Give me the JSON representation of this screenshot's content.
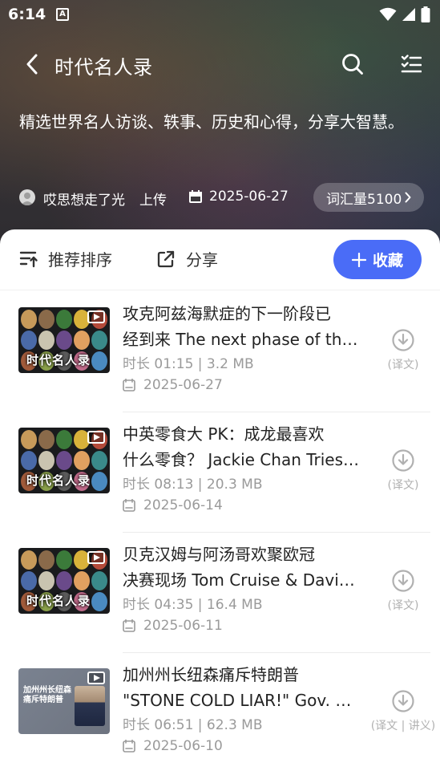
{
  "status": {
    "time": "6:14",
    "badge": "A"
  },
  "nav": {
    "title": "时代名人录"
  },
  "header": {
    "description": "精选世界名人访谈、轶事、历史和心得，分享大智慧。",
    "uploader": "哎思想走了光",
    "upload_word": "上传",
    "date": "2025-06-27",
    "vocab": "词汇量5100"
  },
  "toolbar": {
    "sort_label": "推荐排序",
    "share_label": "分享",
    "favorite_label": "收藏"
  },
  "items": [
    {
      "thumb_label": "时代名人录",
      "title_line1": "攻克阿兹海默症的下一阶段已",
      "title_line2": "经到来 The next phase of the ...",
      "meta": "时长 01:15 | 3.2 MB",
      "date": "2025-06-27",
      "action": "(译文)"
    },
    {
      "thumb_label": "时代名人录",
      "title_line1": "中英零食大 PK：成龙最喜欢",
      "title_line2": "什么零食？ Jackie Chan Tries ...",
      "meta": "时长 08:13 | 20.3 MB",
      "date": "2025-06-14",
      "action": "(译文)"
    },
    {
      "thumb_label": "时代名人录",
      "title_line1": "贝克汉姆与阿汤哥欢聚欧冠",
      "title_line2": "决赛现场 Tom Cruise & David ...",
      "meta": "时长 04:35 | 16.4 MB",
      "date": "2025-06-11",
      "action": "(译文)"
    },
    {
      "thumb_label": "加州州长纽森痛斥特朗普",
      "title_line1": "加州州长纽森痛斥特朗普",
      "title_line2": "\"STONE COLD LIAR!\" Gov. Ne...",
      "meta": "时长 06:51 | 62.3 MB",
      "date": "2025-06-10",
      "action": "(译文 | 讲义)"
    }
  ],
  "colors": {
    "accent": "#4a6cf7",
    "muted": "#9a9a9a"
  }
}
